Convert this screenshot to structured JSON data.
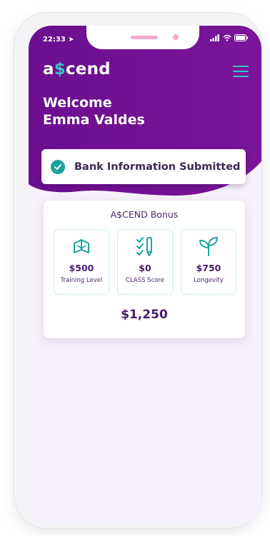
{
  "status_bar": {
    "time": "22:33"
  },
  "header": {
    "logo_prefix": "a",
    "logo_symbol": "$",
    "logo_suffix": "cend",
    "menu_icon": "hamburger-menu-icon"
  },
  "welcome": {
    "line1": "Welcome",
    "line2": "Emma Valdes"
  },
  "banner": {
    "text": "Bank Information Submitted",
    "icon": "check-circle-icon"
  },
  "bonus": {
    "title": "A$CEND Bonus",
    "items": [
      {
        "amount": "$500",
        "label": "Training Level",
        "icon": "book-icon"
      },
      {
        "amount": "$0",
        "label": "CLASS Score",
        "icon": "checklist-icon"
      },
      {
        "amount": "$750",
        "label": "Longevity",
        "icon": "sprout-icon"
      }
    ],
    "total": "$1,250"
  },
  "colors": {
    "brand_purple": "#6a0f8e",
    "accent_teal": "#38c4c6",
    "text_purple": "#4a1d6b",
    "background": "#f6f1fa"
  }
}
